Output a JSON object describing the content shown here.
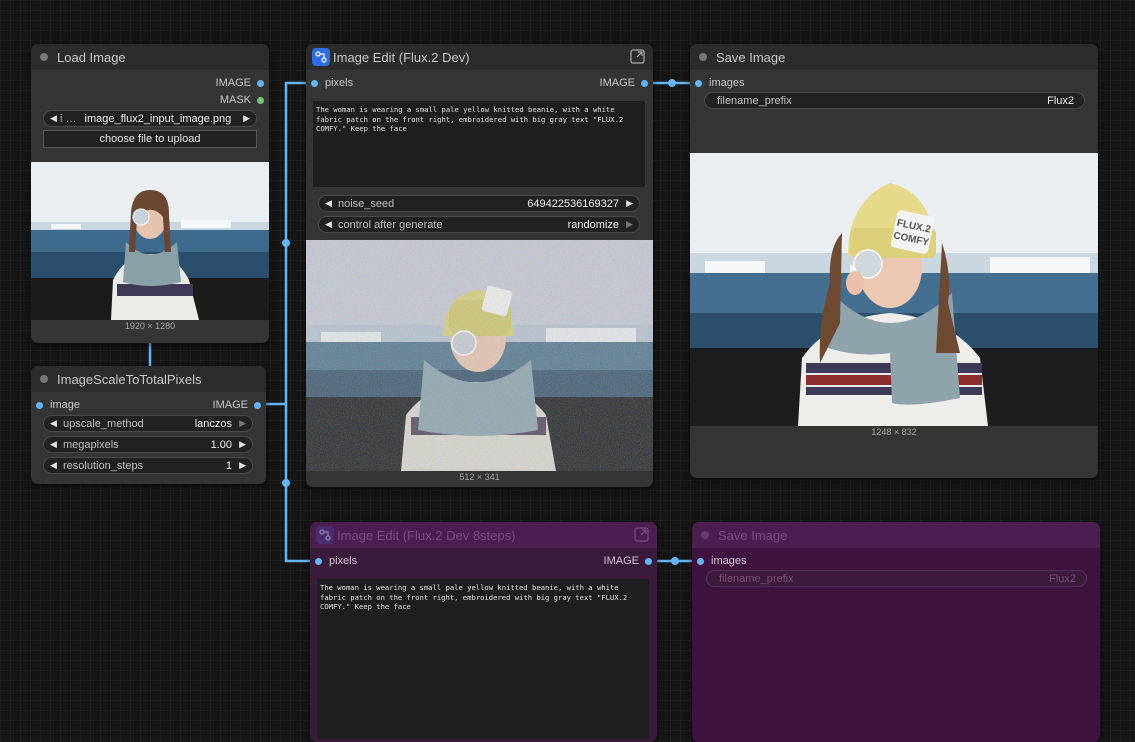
{
  "load_image": {
    "title": "Load Image",
    "outputs": [
      "IMAGE",
      "MASK"
    ],
    "file_prefix": "i …",
    "file_name": "image_flux2_input_image.png",
    "upload_label": "choose file to upload",
    "dims": "1920 × 1280"
  },
  "scale_node": {
    "title": "ImageScaleToTotalPixels",
    "input": "image",
    "output": "IMAGE",
    "widgets": [
      {
        "label": "upscale_method",
        "value": "lanczos"
      },
      {
        "label": "megapixels",
        "value": "1.00"
      },
      {
        "label": "resolution_steps",
        "value": "1"
      }
    ]
  },
  "edit_node": {
    "title": "Image Edit (Flux.2 Dev)",
    "input": "pixels",
    "output": "IMAGE",
    "prompt": "The woman is wearing a small pale yellow knitted beanie, with a white fabric patch on the front right, embroidered with big gray text \"FLUX.2 COMFY.\" Keep the face",
    "widgets": [
      {
        "label": "noise_seed",
        "value": "649422536169327"
      },
      {
        "label": "control after generate",
        "value": "randomize"
      }
    ],
    "dims": "512 × 341"
  },
  "save_node": {
    "title": "Save Image",
    "input": "images",
    "widget_label": "filename_prefix",
    "widget_value": "Flux2",
    "dims": "1248 × 832"
  },
  "edit_node_8": {
    "title": "Image Edit (Flux.2 Dev 8steps)",
    "input": "pixels",
    "output": "IMAGE",
    "prompt": "The woman is wearing a small pale yellow knitted beanie, with a white fabric patch on the front right, embroidered with big gray text \"FLUX.2 COMFY.\" Keep the face"
  },
  "save_node_2": {
    "title": "Save Image",
    "input": "images",
    "widget_label": "filename_prefix",
    "widget_value": "Flux2"
  },
  "photo_text": {
    "line1": "FLUX.2",
    "line2": "COMFY"
  },
  "colors": {
    "link": "#64b5f6",
    "mask_slot": "#7ac37a",
    "bypass": "#4c1d4f",
    "subgraph_icon": "#2f6ee0"
  }
}
